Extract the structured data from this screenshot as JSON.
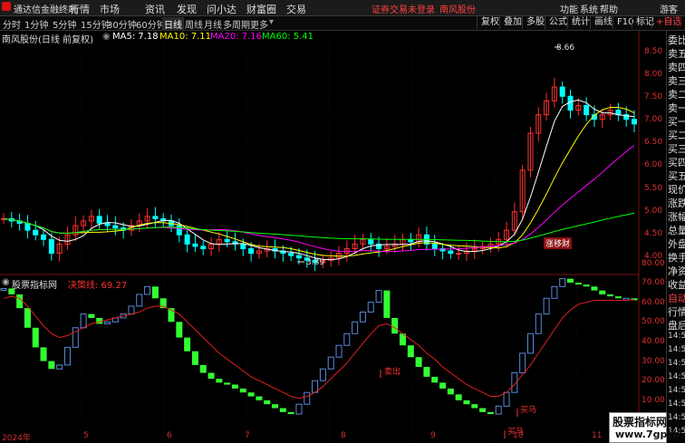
{
  "app": {
    "brand": "通达信金融终端",
    "menu": [
      "行情",
      "市场",
      "资讯",
      "发现",
      "问小达",
      "财富圈",
      "交易"
    ],
    "alert": "证券交易未登录",
    "stock_link": "南风股份",
    "right_menu": [
      "功能",
      "系统",
      "帮助"
    ],
    "guest": "游客"
  },
  "timeframes": [
    "分时",
    "1分钟",
    "5分钟",
    "15分钟",
    "30分钟",
    "60分钟",
    "日线",
    "周线",
    "月线",
    "多周期",
    "更多"
  ],
  "active_timeframe": "日线",
  "tools": [
    "复权",
    "叠加",
    "多股",
    "公式",
    "统计",
    "画线",
    "F10",
    "标记",
    "+自选"
  ],
  "main_panel": {
    "title": "南风股份(日线 前复权)",
    "ma": [
      {
        "label": "MA5: 7.18",
        "color": "#ffffff"
      },
      {
        "label": "MA10: 7.11",
        "color": "#ffff00"
      },
      {
        "label": "MA20: 7.16",
        "color": "#ff00ff"
      },
      {
        "label": "MA60: 5.41",
        "color": "#00ff00"
      }
    ],
    "y_ticks": [
      "8.50",
      "8.00",
      "7.50",
      "7.00",
      "6.50",
      "6.00",
      "5.50",
      "5.00",
      "4.50",
      "4.00"
    ],
    "annotations": {
      "high": "8.66",
      "low": "3.89"
    },
    "chip_label": "涨移财"
  },
  "indicator_panel": {
    "title": "股票指标网",
    "line_label": "决策线: 69.27",
    "y_ticks": [
      "80.00",
      "70.00",
      "60.00",
      "50.00",
      "40.00",
      "30.00",
      "20.00",
      "10.00"
    ],
    "signals": [
      "卖出",
      "买马",
      "买马"
    ]
  },
  "x_axis": [
    "2024年",
    "5",
    "6",
    "7",
    "8",
    "9",
    "10",
    "11"
  ],
  "side_panel": [
    "委比",
    "卖五",
    "卖四",
    "卖三",
    "卖二",
    "卖一",
    "买一",
    "买二",
    "买三",
    "买四",
    "买五",
    "现价",
    "涨跌",
    "涨幅",
    "总量",
    "外盘",
    "换手",
    "净资",
    "收益",
    "自动",
    "行情",
    "盘后",
    "14:50",
    "14:50",
    "14:50",
    "14:50",
    "14:50",
    "14:50",
    "14:50",
    "14:50"
  ],
  "watermark": {
    "line1": "股票指标网",
    "line2": "www.7gpzb.com"
  },
  "colors": {
    "up": "#ff3030",
    "down": "#00ffff",
    "ind_up": "#5a8ad8",
    "ind_down": "#33ff33",
    "decision": "#e02020"
  },
  "chart_data": {
    "type": "candlestick",
    "title": "南风股份(日线 前复权)",
    "ylim": [
      3.8,
      8.9
    ],
    "close": [
      4.95,
      4.9,
      4.85,
      4.7,
      4.6,
      4.5,
      4.2,
      4.4,
      4.6,
      4.8,
      4.9,
      5.0,
      4.85,
      4.8,
      4.75,
      4.7,
      4.8,
      4.9,
      5.0,
      4.95,
      4.9,
      4.8,
      4.6,
      4.4,
      4.35,
      4.3,
      4.4,
      4.5,
      4.45,
      4.4,
      4.3,
      4.2,
      4.25,
      4.3,
      4.25,
      4.2,
      4.15,
      4.1,
      4.05,
      4.0,
      4.05,
      4.1,
      4.2,
      4.3,
      4.4,
      4.5,
      4.4,
      4.3,
      4.35,
      4.4,
      4.5,
      4.45,
      4.6,
      4.4,
      4.3,
      4.25,
      4.2,
      4.2,
      4.25,
      4.3,
      4.35,
      4.4,
      4.5,
      4.7,
      5.1,
      6.0,
      6.8,
      7.2,
      7.5,
      7.8,
      7.6,
      7.3,
      7.4,
      7.2,
      7.1,
      7.2,
      7.3,
      7.2,
      7.1,
      7.0
    ],
    "ma_series": [
      {
        "name": "MA5",
        "last": 7.18
      },
      {
        "name": "MA10",
        "last": 7.11
      },
      {
        "name": "MA20",
        "last": 7.16
      },
      {
        "name": "MA60",
        "last": 5.41
      }
    ],
    "indicator": {
      "ylim": [
        5,
        90
      ],
      "values": [
        75,
        72,
        65,
        55,
        45,
        38,
        34,
        36,
        45,
        55,
        62,
        60,
        57,
        58,
        60,
        62,
        66,
        72,
        76,
        70,
        65,
        58,
        50,
        43,
        36,
        32,
        29,
        27,
        26,
        24,
        22,
        20,
        18,
        16,
        14,
        12,
        11,
        16,
        22,
        28,
        34,
        40,
        46,
        52,
        58,
        63,
        68,
        74,
        60,
        52,
        46,
        40,
        35,
        30,
        27,
        24,
        21,
        18,
        16,
        14,
        12,
        11,
        15,
        22,
        32,
        42,
        52,
        62,
        70,
        76,
        80,
        78,
        77,
        76,
        74,
        72,
        71,
        70,
        70,
        69
      ],
      "decision": [
        70,
        71,
        70,
        66,
        61,
        56,
        52,
        50,
        51,
        53,
        55,
        57,
        58,
        59,
        60,
        61,
        62,
        63,
        65,
        66,
        66,
        64,
        62,
        58,
        54,
        50,
        46,
        42,
        39,
        36,
        33,
        30,
        28,
        26,
        24,
        22,
        20,
        19,
        20,
        22,
        25,
        29,
        33,
        37,
        42,
        47,
        52,
        56,
        57,
        55,
        52,
        49,
        46,
        42,
        39,
        35,
        32,
        29,
        26,
        24,
        22,
        20,
        20,
        22,
        26,
        31,
        36,
        42,
        48,
        54,
        60,
        64,
        67,
        68,
        69,
        69,
        69,
        69,
        69,
        69.27
      ]
    }
  }
}
